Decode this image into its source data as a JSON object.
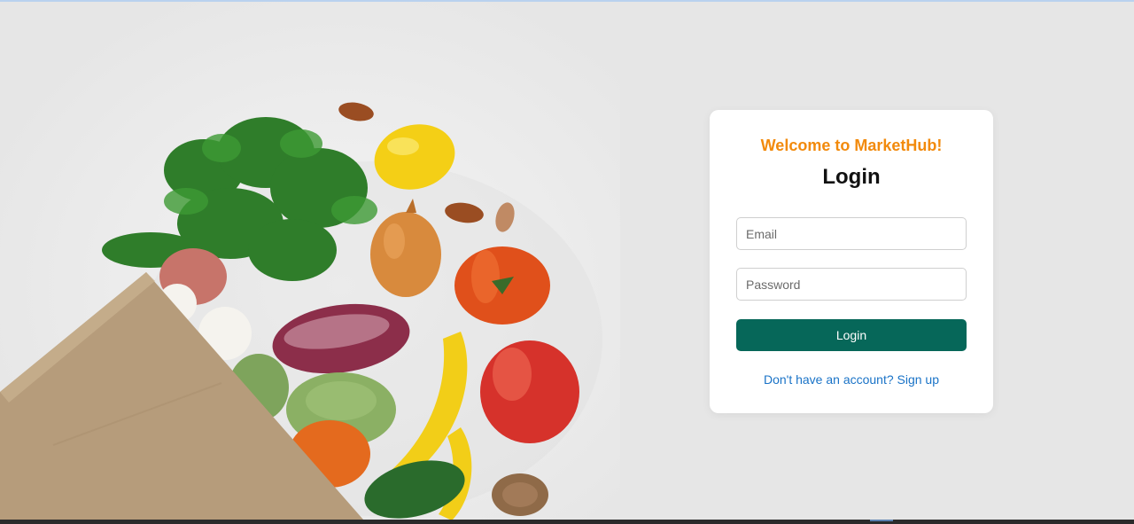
{
  "hero": {
    "image_name": "grocery-bag-with-vegetables"
  },
  "login_card": {
    "welcome_text": "Welcome to MarketHub!",
    "title": "Login",
    "email_placeholder": "Email",
    "password_placeholder": "Password",
    "login_button_label": "Login",
    "signup_prompt": "Don't have an account? Sign up"
  },
  "colors": {
    "accent_orange": "#f28a0c",
    "primary_button": "#066759",
    "link_blue": "#1a73c7",
    "page_background": "#e6e6e6"
  }
}
